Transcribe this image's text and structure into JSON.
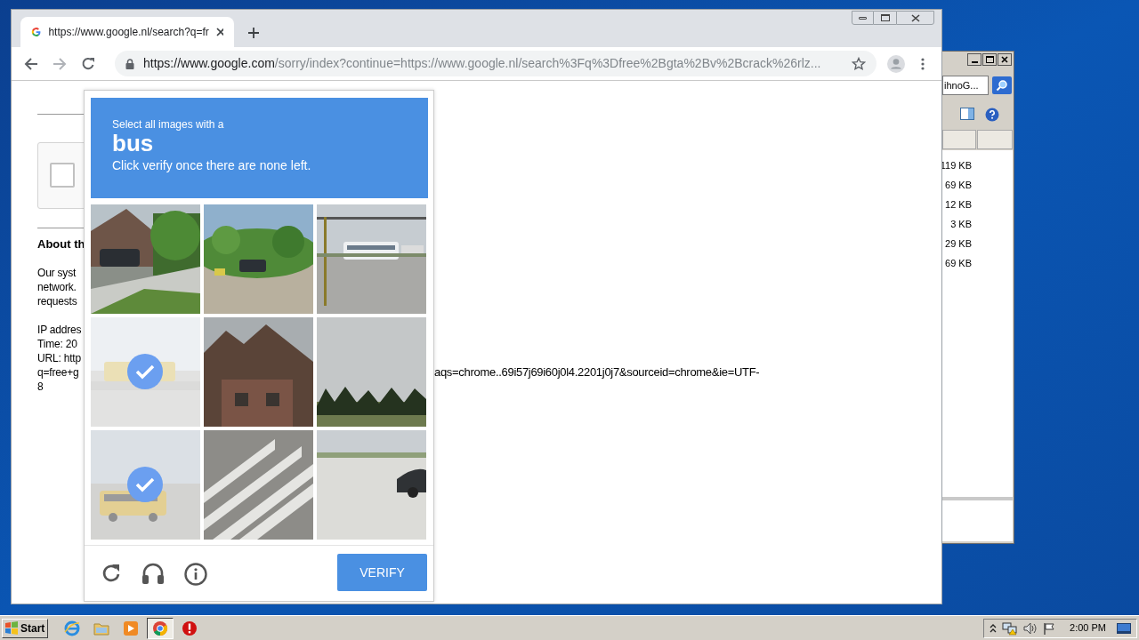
{
  "browser": {
    "tab": {
      "title": "https://www.google.nl/search?q=fr",
      "selected": true
    },
    "address": {
      "host": "https://www.google.com",
      "path": "/sorry/index?continue=https://www.google.nl/search%3Fq%3Dfree%2Bgta%2Bv%2Bcrack%26rlz..."
    }
  },
  "page": {
    "checkbox": {
      "checked": false
    },
    "heading": "About th",
    "paragraph_lines": [
      "Our syst",
      "network.",
      "requests"
    ],
    "detail_lines": [
      "IP addres",
      "Time: 20",
      "URL: http",
      "q=free+g",
      "8"
    ],
    "url_tail": "aqs=chrome..69i57j69i60j0l4.2201j0j7&sourceid=chrome&ie=UTF-"
  },
  "captcha": {
    "prompt": "Select all images with a",
    "target": "bus",
    "instruction": "Click verify once there are none left.",
    "tiles": [
      {
        "selected": false
      },
      {
        "selected": false
      },
      {
        "selected": false
      },
      {
        "selected": true
      },
      {
        "selected": false
      },
      {
        "selected": false
      },
      {
        "selected": true
      },
      {
        "selected": false
      },
      {
        "selected": false
      }
    ],
    "verify_button": "VERIFY"
  },
  "explorer": {
    "search": {
      "value": "ihnoG..."
    },
    "sizes": [
      "119 KB",
      "69 KB",
      "12 KB",
      "3 KB",
      "29 KB",
      "69 KB"
    ]
  },
  "taskbar": {
    "start": "Start",
    "apps": [
      {
        "kind": "ie",
        "selected": false
      },
      {
        "kind": "folder",
        "selected": false
      },
      {
        "kind": "player",
        "selected": false
      },
      {
        "kind": "chrome",
        "selected": true
      },
      {
        "kind": "stop",
        "selected": false
      }
    ],
    "clock": "2:00 PM"
  }
}
